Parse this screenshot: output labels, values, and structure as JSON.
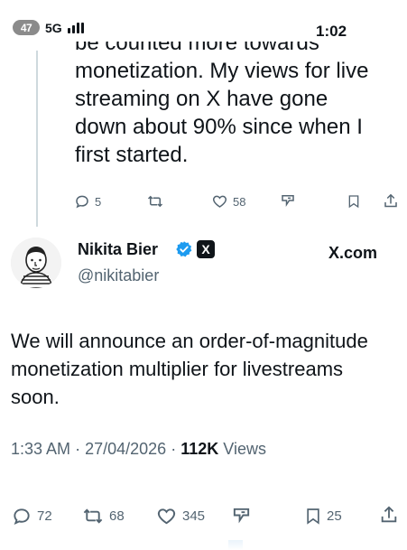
{
  "status_bar": {
    "battery": "47",
    "network": "5G",
    "time": "1:02"
  },
  "previous_tweet": {
    "clipped_line": "be counted more towards",
    "lines": [
      "monetization. My views for live",
      "streaming on X have gone",
      "down about 90% since when I",
      "first started."
    ],
    "actions": {
      "replies": "5",
      "likes": "58"
    }
  },
  "author": {
    "name": "Nikita Bier",
    "handle": "@nikitabier",
    "badge_letter": "X",
    "affiliation": "X.com"
  },
  "tweet": {
    "lines": [
      "We will announce an order-of-magnitude",
      "monetization multiplier for livestreams",
      "soon."
    ],
    "time": "1:33 AM",
    "date": "27/04/2026",
    "views_count": "112K",
    "views_label": "Views",
    "separator": "·",
    "actions": {
      "replies": "72",
      "reposts": "68",
      "likes": "345",
      "bookmarks": "25"
    }
  },
  "colors": {
    "text": "#0f1419",
    "secondary": "#536471",
    "verified": "#1d9bf0",
    "thread_line": "#cfd9de"
  }
}
